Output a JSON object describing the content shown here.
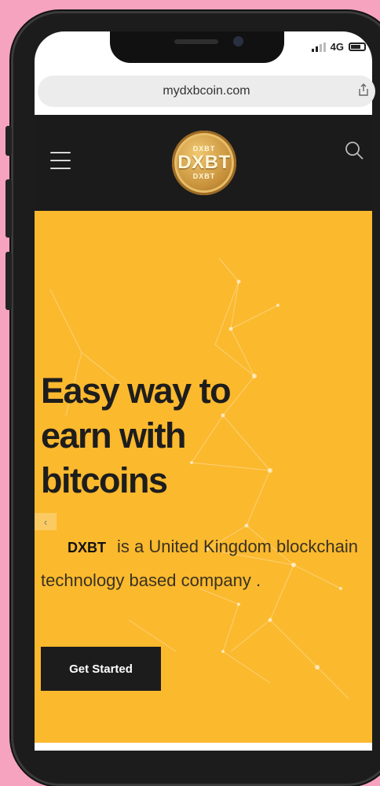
{
  "status_bar": {
    "network": "4G"
  },
  "browser": {
    "url": "mydxbcoin.com",
    "share_icon": "share-icon"
  },
  "navbar": {
    "menu_icon": "hamburger-menu-icon",
    "logo": {
      "main": "DXBT",
      "top": "DXBT",
      "bottom": "DXBT"
    },
    "search_icon": "search-icon"
  },
  "hero": {
    "headline": [
      "Easy way to",
      "earn with",
      "bitcoins"
    ],
    "brand": "DXBT",
    "description": "is a United Kingdom blockchain technology based company .",
    "cta_label": "Get Started",
    "prev_arrow": "‹"
  },
  "colors": {
    "accent": "#fbb92e",
    "nav": "#1b1b1b",
    "button": "#1c1c1c",
    "background": "#f6a3bf"
  }
}
